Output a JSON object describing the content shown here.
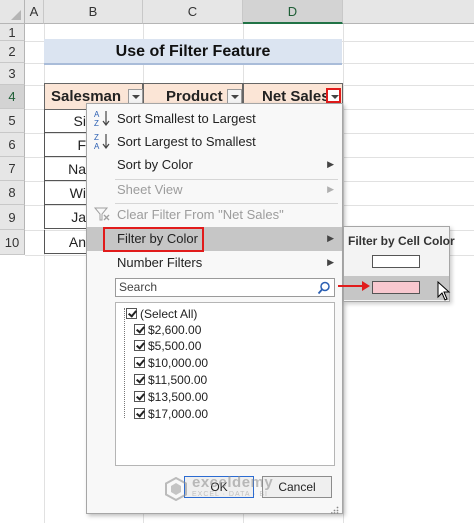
{
  "spreadsheet": {
    "columns": [
      "A",
      "B",
      "C",
      "D"
    ],
    "rows": [
      "1",
      "2",
      "3",
      "4",
      "5",
      "6",
      "7",
      "8",
      "9",
      "10"
    ],
    "title": "Use of Filter Feature",
    "headers": {
      "salesman": "Salesman",
      "product": "Product",
      "net_sales": "Net Sales"
    },
    "salesman_partial": [
      "Si",
      "F",
      "Na",
      "Wi",
      "Ja",
      "An"
    ],
    "colors": {
      "title_fill": "#dbe4f1",
      "header_fill": "#fbe5d6",
      "highlight": "#e11b1b"
    }
  },
  "filter_menu": {
    "items": [
      {
        "label": "Sort Smallest to Largest",
        "icon": "sort-ascending-icon",
        "enabled": true
      },
      {
        "label": "Sort Largest to Smallest",
        "icon": "sort-descending-icon",
        "enabled": true
      },
      {
        "label": "Sort by Color",
        "enabled": true,
        "submenu": true
      },
      {
        "label": "Sheet View",
        "enabled": false,
        "submenu": true
      },
      {
        "label": "Clear Filter From \"Net Sales\"",
        "icon": "clear-filter-icon",
        "enabled": false
      },
      {
        "label": "Filter by Color",
        "enabled": true,
        "submenu": true,
        "selected": true
      },
      {
        "label": "Number Filters",
        "enabled": true,
        "submenu": true
      }
    ],
    "search_placeholder": "Search",
    "values": [
      {
        "label": "(Select All)",
        "checked": true
      },
      {
        "label": "$2,600.00",
        "checked": true
      },
      {
        "label": "$5,500.00",
        "checked": true
      },
      {
        "label": "$10,000.00",
        "checked": true
      },
      {
        "label": "$11,500.00",
        "checked": true
      },
      {
        "label": "$13,500.00",
        "checked": true
      },
      {
        "label": "$17,000.00",
        "checked": true
      }
    ],
    "ok_label": "OK",
    "cancel_label": "Cancel"
  },
  "submenu": {
    "header": "Filter by Cell Color",
    "swatches": [
      {
        "color": "#ffffff",
        "name": "no-fill"
      },
      {
        "color": "#f8c8cf",
        "name": "pink",
        "selected": true
      }
    ]
  },
  "watermark": {
    "name": "exceldemy",
    "tagline": "EXCEL · DATA · BI"
  }
}
